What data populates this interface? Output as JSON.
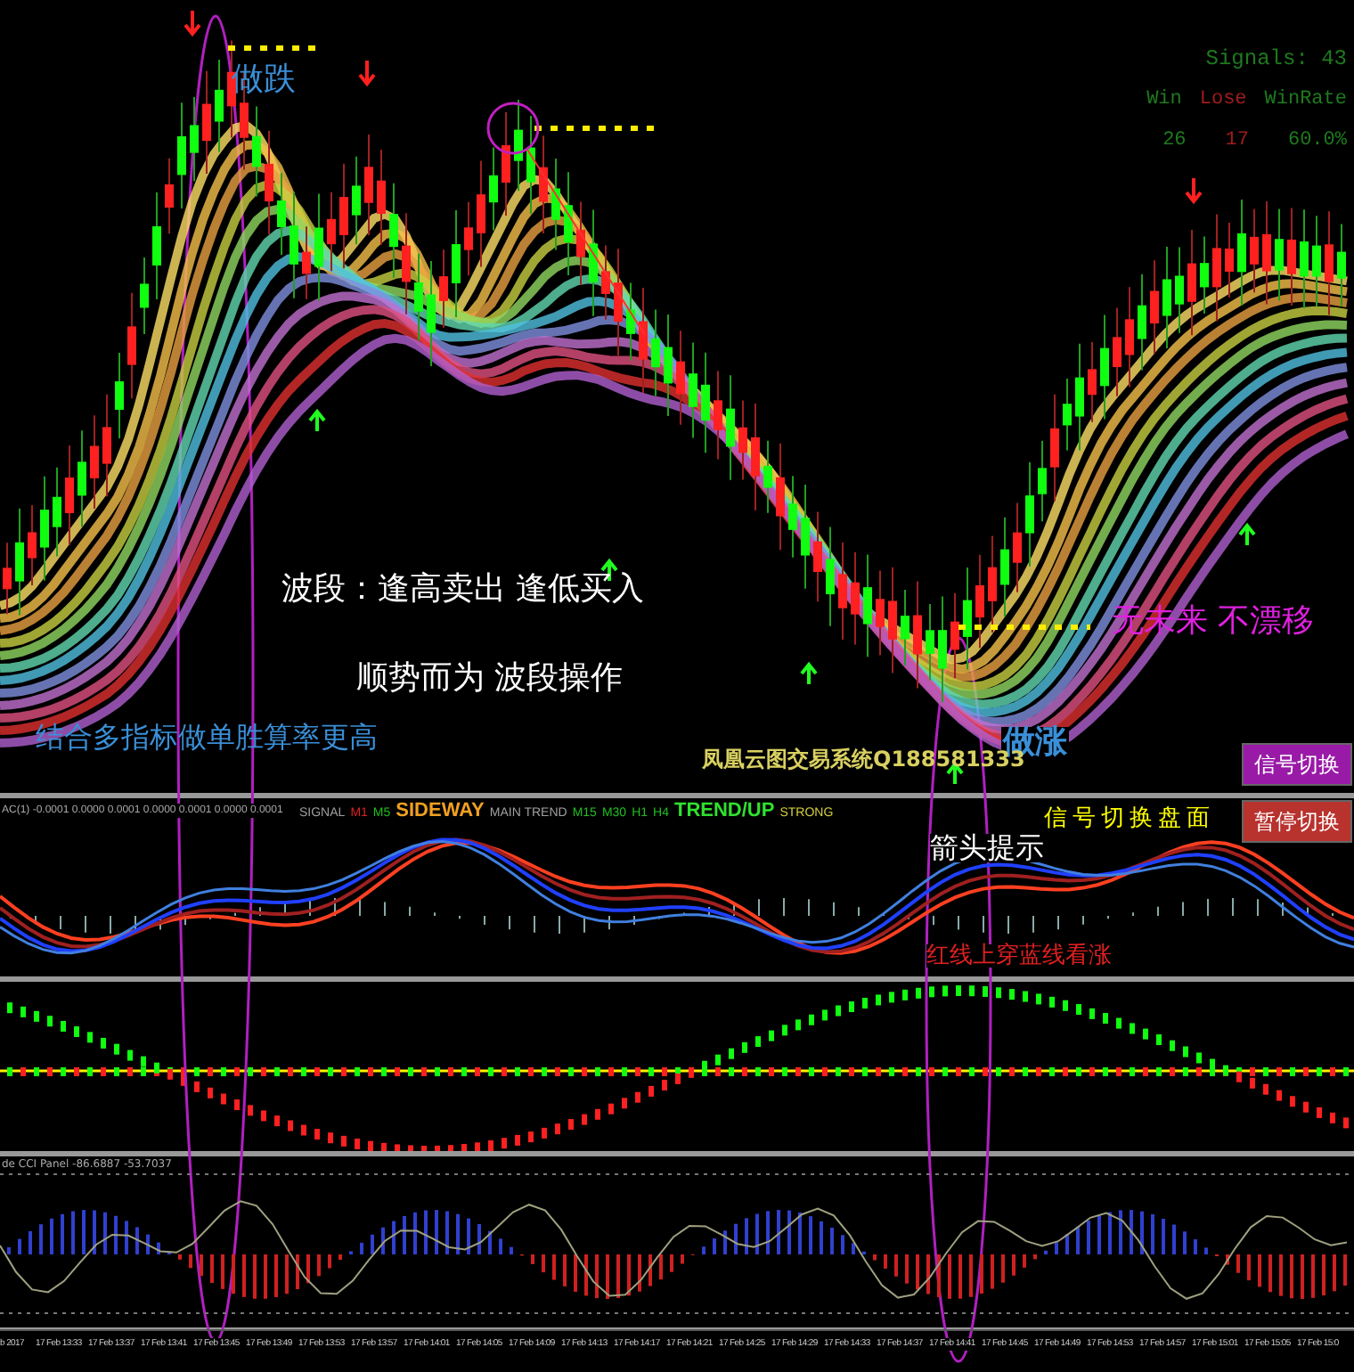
{
  "signal_stats": {
    "title": "Signals: 43",
    "headers": [
      {
        "text": "Win",
        "color": "#1e7a1e"
      },
      {
        "text": "Lose",
        "color": "#a01c1c"
      },
      {
        "text": "WinRate",
        "color": "#1e7a1e"
      }
    ],
    "values": [
      {
        "text": "26",
        "color": "#1e7a1e"
      },
      {
        "text": "17",
        "color": "#a01c1c"
      },
      {
        "text": "60.0%",
        "color": "#1e7a1e"
      }
    ]
  },
  "annotations": [
    {
      "text": "做跌",
      "color": "#3a8fd8"
    },
    {
      "text": "波段：逢高卖出 逢低买入",
      "color": "#ffffff"
    },
    {
      "text": "顺势而为 波段操作",
      "color": "#ffffff"
    },
    {
      "text": "结合多指标做单胜算率更高",
      "color": "#3a8fd8"
    },
    {
      "text": "做涨",
      "color": "#3a8fd8"
    },
    {
      "text": "无未来 不漂移",
      "color": "#e020e0"
    },
    {
      "text": "凤凰云图交易系统Q188581333",
      "color": "#d8d060"
    }
  ],
  "buttons": [
    {
      "label": "信号切换",
      "color": "#9a1aa8"
    },
    {
      "label": "暂停切换",
      "color": "#b8322e"
    }
  ],
  "oscillator_panel": {
    "label": "AC(1) -0.0001 0.0000 0.0001 0.0000 0.0001 0.0000 0.0001",
    "trend_bar": [
      {
        "text": "SIGNAL",
        "color": "#a0a0a0"
      },
      {
        "text": "M1",
        "color": "#e02020"
      },
      {
        "text": "M5",
        "color": "#20c020"
      },
      {
        "text": "SIDEWAY",
        "color": "#f0a020"
      },
      {
        "text": "MAIN TREND",
        "color": "#a0a0a0"
      },
      {
        "text": "M15",
        "color": "#20c020"
      },
      {
        "text": "M30",
        "color": "#20c020"
      },
      {
        "text": "H1",
        "color": "#20c020"
      },
      {
        "text": "H4",
        "color": "#20c020"
      },
      {
        "text": "TREND/UP",
        "color": "#30e030"
      },
      {
        "text": "STRONG",
        "color": "#d8d040"
      }
    ],
    "notes": [
      {
        "text": "信号切换盘面",
        "color": "#ffff00"
      },
      {
        "text": "箭头提示",
        "color": "#ffffff"
      },
      {
        "text": "红线上穿蓝线看涨",
        "color": "#e02020"
      }
    ]
  },
  "cci_panel": {
    "label": "de CCI Panel -86.6887 -53.7037"
  },
  "time_axis": [
    "b 2017",
    "17 Feb 13:33",
    "17 Feb 13:37",
    "17 Feb 13:41",
    "17 Feb 13:45",
    "17 Feb 13:49",
    "17 Feb 13:53",
    "17 Feb 13:57",
    "17 Feb 14:01",
    "17 Feb 14:05",
    "17 Feb 14:09",
    "17 Feb 14:13",
    "17 Feb 14:17",
    "17 Feb 14:21",
    "17 Feb 14:25",
    "17 Feb 14:29",
    "17 Feb 14:33",
    "17 Feb 14:37",
    "17 Feb 14:41",
    "17 Feb 14:45",
    "17 Feb 14:49",
    "17 Feb 14:53",
    "17 Feb 14:57",
    "17 Feb 15:01",
    "17 Feb 15:05",
    "17 Feb 15:0"
  ]
}
